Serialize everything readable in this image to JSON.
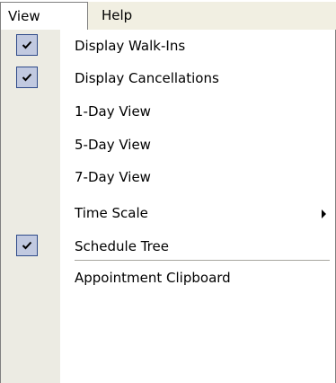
{
  "menubar": {
    "items": [
      {
        "label": "View"
      },
      {
        "label": "Help"
      }
    ]
  },
  "view_menu": {
    "items": [
      {
        "label": "Display Walk-Ins",
        "checked": true
      },
      {
        "label": "Display Cancellations",
        "checked": true
      },
      {
        "label": "1-Day View",
        "checked": false
      },
      {
        "label": "5-Day View",
        "checked": false
      },
      {
        "label": "7-Day View",
        "checked": false
      },
      {
        "label": "Time Scale",
        "checked": false,
        "submenu": true
      },
      {
        "label": "Schedule Tree",
        "checked": true
      },
      {
        "label": "Appointment Clipboard",
        "checked": false
      }
    ]
  },
  "colors": {
    "menubar_bg": "#f1efe2",
    "gutter_bg": "#ecebe3",
    "check_bg": "#c1c9e0",
    "check_border": "#2f4b8a"
  },
  "icons": {
    "check": "checkmark-icon",
    "submenu": "triangle-right-icon"
  }
}
